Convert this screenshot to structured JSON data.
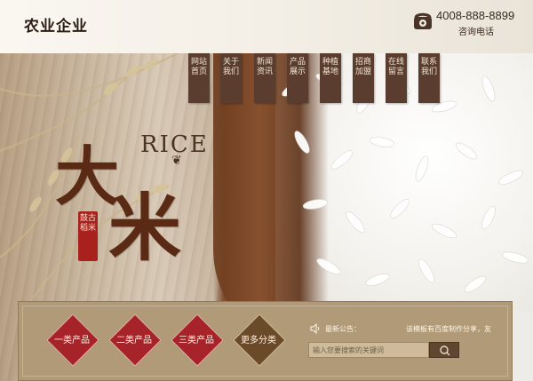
{
  "header": {
    "logo": "农业企业",
    "phone_number": "4008-888-8899",
    "phone_label": "咨询电话"
  },
  "nav": {
    "items": [
      {
        "label": "网站首页"
      },
      {
        "label": "关于我们"
      },
      {
        "label": "新闻资讯"
      },
      {
        "label": "产品展示"
      },
      {
        "label": "种植基地"
      },
      {
        "label": "招商加盟"
      },
      {
        "label": "在线留言"
      },
      {
        "label": "联系我们"
      }
    ]
  },
  "hero": {
    "title_chars": [
      "大",
      "米"
    ],
    "english": "RICE",
    "seal_text": "鼓古稻米"
  },
  "categories": [
    {
      "label": "一类产品"
    },
    {
      "label": "二类产品"
    },
    {
      "label": "三类产品"
    },
    {
      "label": "更多分类"
    }
  ],
  "notice": {
    "label": "最新公告：",
    "text": "该模板有百度制作分享，友"
  },
  "search": {
    "placeholder": "输入您要搜索的关键词"
  },
  "colors": {
    "nav_bg": "#5a3d2e",
    "accent_red": "#a6232a",
    "panel_bg": "#b09a78"
  }
}
